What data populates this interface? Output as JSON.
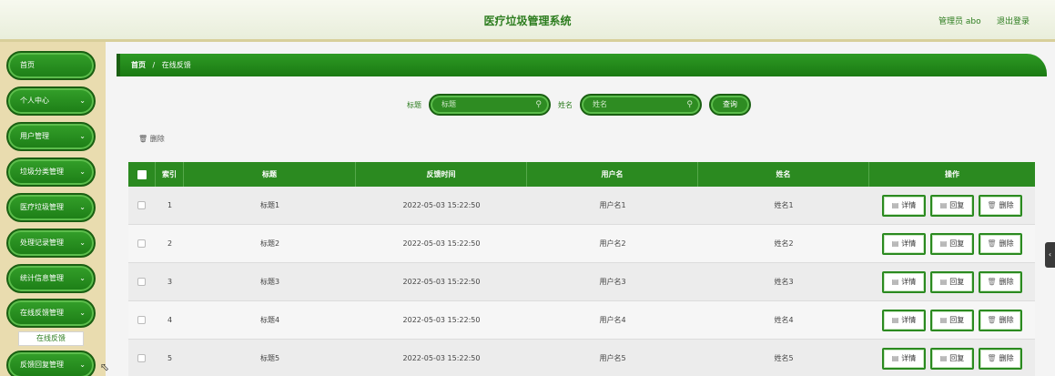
{
  "header": {
    "title": "医疗垃圾管理系统",
    "admin_label": "管理员 abo",
    "logout_label": "退出登录"
  },
  "sidebar": {
    "items": [
      {
        "label": "首页",
        "chevron": false
      },
      {
        "label": "个人中心",
        "chevron": true
      },
      {
        "label": "用户管理",
        "chevron": true
      },
      {
        "label": "垃圾分类管理",
        "chevron": true
      },
      {
        "label": "医疗垃圾管理",
        "chevron": true
      },
      {
        "label": "处理记录管理",
        "chevron": true
      },
      {
        "label": "统计信息管理",
        "chevron": true
      },
      {
        "label": "在线反馈管理",
        "chevron": true
      },
      {
        "label": "反馈回复管理",
        "chevron": true
      }
    ],
    "sub_item": "在线反馈"
  },
  "breadcrumb": {
    "home": "首页",
    "separator": "/",
    "current": "在线反馈"
  },
  "search": {
    "title_label": "标题",
    "title_placeholder": "标题",
    "name_label": "姓名",
    "name_placeholder": "姓名",
    "query_button": "查询"
  },
  "toolbar": {
    "delete_label": "删除"
  },
  "table": {
    "columns": [
      "索引",
      "标题",
      "反馈时间",
      "用户名",
      "姓名",
      "操作"
    ],
    "rows": [
      {
        "index": "1",
        "title": "标题1",
        "time": "2022-05-03 15:22:50",
        "username": "用户名1",
        "name": "姓名1"
      },
      {
        "index": "2",
        "title": "标题2",
        "time": "2022-05-03 15:22:50",
        "username": "用户名2",
        "name": "姓名2"
      },
      {
        "index": "3",
        "title": "标题3",
        "time": "2022-05-03 15:22:50",
        "username": "用户名3",
        "name": "姓名3"
      },
      {
        "index": "4",
        "title": "标题4",
        "time": "2022-05-03 15:22:50",
        "username": "用户名4",
        "name": "姓名4"
      },
      {
        "index": "5",
        "title": "标题5",
        "time": "2022-05-03 15:22:50",
        "username": "用户名5",
        "name": "姓名5"
      }
    ],
    "actions": {
      "detail": "详情",
      "reply": "回复",
      "delete": "删除"
    }
  },
  "colors": {
    "primary_green": "#2b8a20",
    "title_green": "#2d7d1f",
    "sidebar_bg": "#e9dcaf"
  },
  "icons": {
    "search": "search-icon",
    "delete": "trash-icon",
    "detail": "document-icon",
    "reply": "edit-icon",
    "chevron": "chevron-down-icon",
    "side_handle": "chevron-left-icon"
  }
}
